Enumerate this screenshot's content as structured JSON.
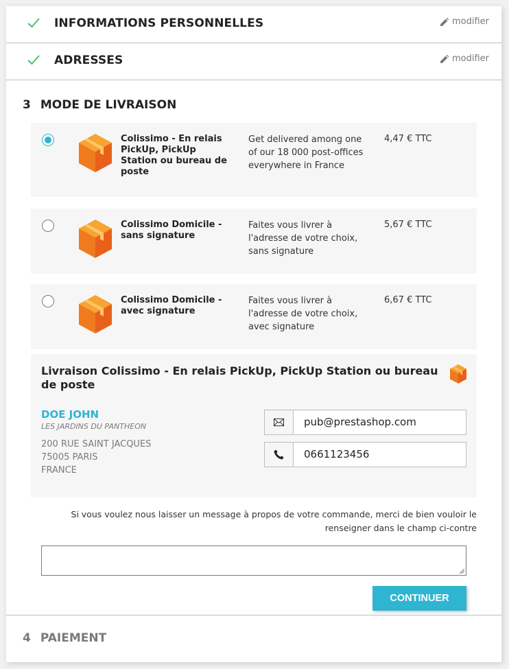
{
  "steps": {
    "personal": {
      "title": "Informations personnelles",
      "edit_label": "modifier"
    },
    "addresses": {
      "title": "Adresses",
      "edit_label": "modifier"
    },
    "delivery": {
      "number": "3",
      "title": "MODE DE LIVRAISON",
      "carriers": [
        {
          "name": "Colissimo - En relais PickUp, PickUp Station ou bureau de poste",
          "description": "Get delivered among one of our 18 000 post-offices everywhere in France",
          "price": "4,47 € TTC",
          "selected": true
        },
        {
          "name": "Colissimo Domicile - sans signature",
          "description": "Faites vous livrer à l'adresse de votre choix, sans signature",
          "price": "5,67 € TTC",
          "selected": false
        },
        {
          "name": "Colissimo Domicile - avec signature",
          "description": "Faites vous livrer à l'adresse de votre choix, avec signature",
          "price": "6,67 € TTC",
          "selected": false
        }
      ],
      "relay": {
        "title": "Livraison Colissimo - En relais PickUp, PickUp Station ou bureau de poste",
        "name": "DOE JOHN",
        "company": "LES JARDINS DU PANTHEON",
        "address_line1": "200 RUE SAINT JACQUES",
        "address_line2": "75005 PARIS",
        "country": "FRANCE",
        "email": "pub@prestashop.com",
        "phone": "0661123456"
      },
      "message_label": "Si vous voulez nous laisser un message à propos de votre commande, merci de bien vouloir le renseigner dans le champ ci-contre",
      "message_value": "",
      "continue_label": "Continuer"
    },
    "payment": {
      "number": "4",
      "title": "PAIEMENT"
    }
  },
  "colors": {
    "accent": "#2fb5d2",
    "check": "#4cbb6c",
    "muted": "#7a7a7a"
  },
  "icons": {
    "done": "check-icon",
    "edit": "pencil-icon",
    "carrier": "parcel-box-icon",
    "email": "envelope-icon",
    "phone": "phone-icon"
  }
}
